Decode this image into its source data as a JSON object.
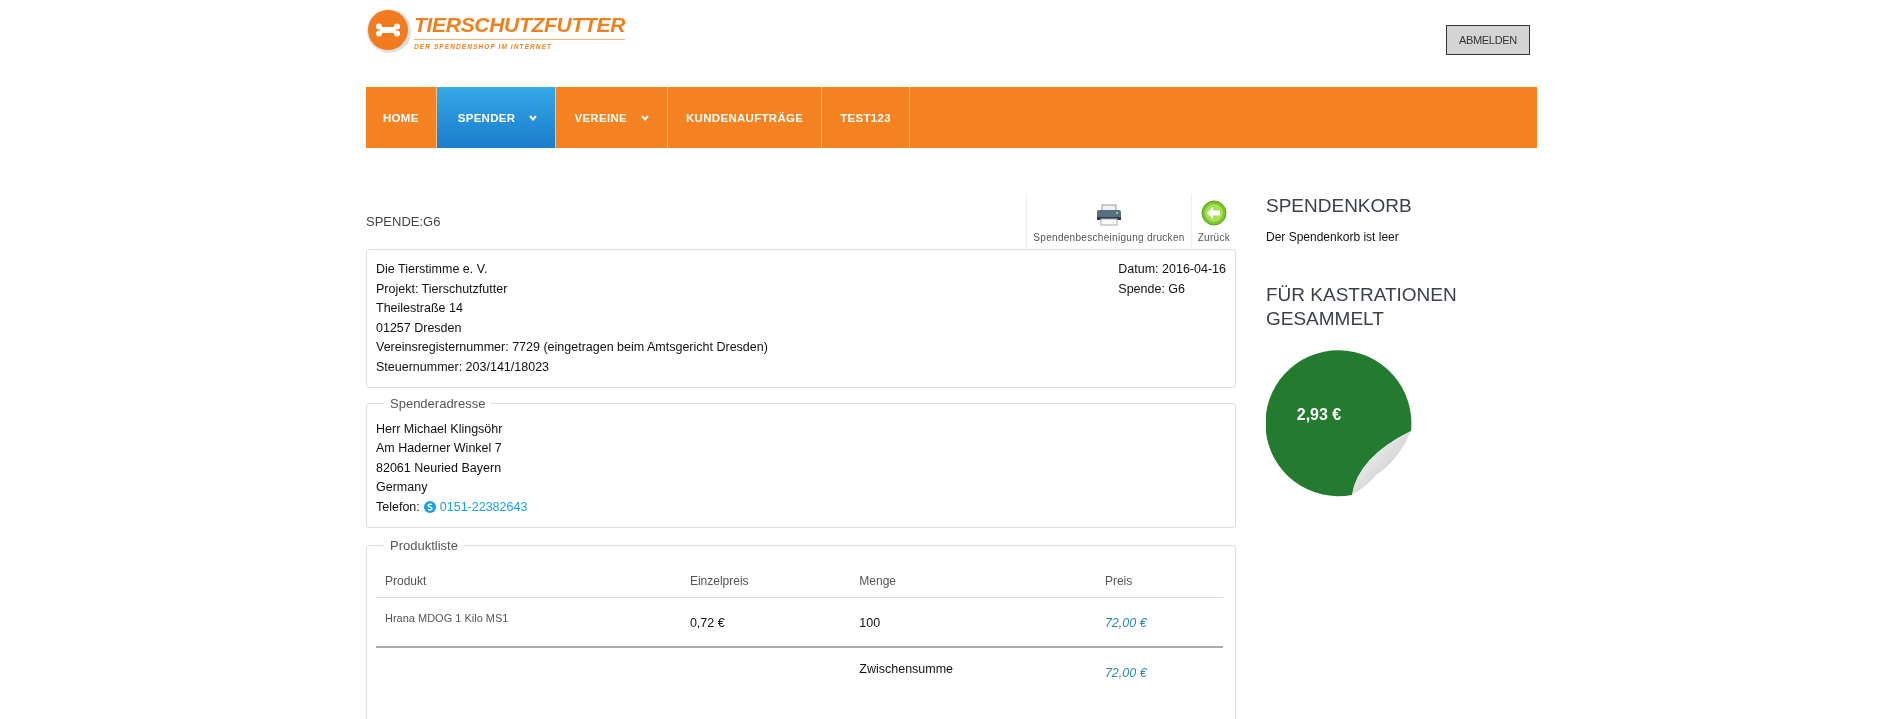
{
  "logo": {
    "title": "TIERSCHUTZFUTTER",
    "tagline": "DER SPENDENSHOP IM INTERNET"
  },
  "logout_button": "ABMELDEN",
  "nav": [
    {
      "label": "HOME",
      "selected": false,
      "has_dropdown": false
    },
    {
      "label": "SPENDER",
      "selected": true,
      "has_dropdown": true
    },
    {
      "label": "VEREINE",
      "selected": false,
      "has_dropdown": true
    },
    {
      "label": "KUNDENAUFTRÄGE",
      "selected": false,
      "has_dropdown": false
    },
    {
      "label": "TEST123",
      "selected": false,
      "has_dropdown": false
    }
  ],
  "page_title": "SPENDE:G6",
  "actions": [
    {
      "kind": "print",
      "label": "Spendenbescheinigung drucken"
    },
    {
      "kind": "back",
      "label": "Zurück"
    }
  ],
  "organization": {
    "lines": [
      "Die Tierstimme e. V.",
      "Projekt: Tierschutzfutter",
      "Theilestraße 14",
      "01257 Dresden",
      "Vereinsregisternummer: 7729 (eingetragen beim Amtsgericht Dresden)",
      "Steuernummer: 203/141/18023"
    ],
    "meta": [
      "Datum: 2016-04-16",
      "Spende: G6"
    ]
  },
  "donor_address": {
    "legend": "Spenderadresse",
    "lines": [
      "Herr Michael Klingsöhr",
      "Am Haderner Winkel 7",
      "82061 Neuried Bayern",
      "Germany"
    ],
    "phone_label": "Telefon:",
    "phone": "0151-22382643"
  },
  "product_list": {
    "legend": "Produktliste",
    "columns": [
      "Produkt",
      "Einzelpreis",
      "Menge",
      "Preis"
    ],
    "rows": [
      {
        "product": "Hrana MDOG 1 Kilo MS1",
        "unit_price": "0,72 €",
        "quantity": "100",
        "price": "72,00 €"
      }
    ],
    "subtotal_label": "Zwischensumme",
    "subtotal": "72,00 €"
  },
  "sidebar": {
    "cart_title": "SPENDENKORB",
    "cart_text": "Der Spendenkorb ist leer",
    "collected_title": "FÜR KASTRATIONEN GESAMMELT",
    "collected_amount": "2,93 €"
  }
}
